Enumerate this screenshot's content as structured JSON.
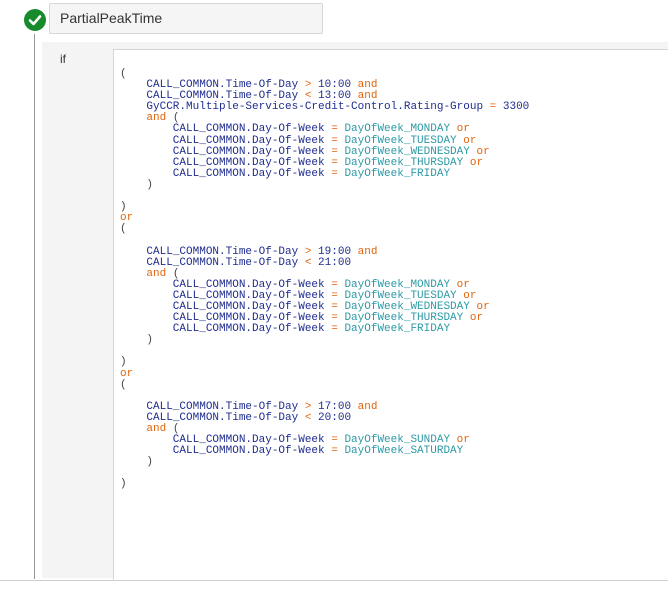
{
  "condition": {
    "name": "PartialPeakTime",
    "status_icon": "check-circle-icon",
    "if_label": "if"
  },
  "colors": {
    "identifier": "#1f2d8f",
    "keyword": "#e2640c",
    "constant": "#2c9aa6",
    "status_ok": "#178a2c"
  },
  "code_lines": [
    [
      {
        "t": "(",
        "k": "p"
      }
    ],
    [
      {
        "t": "    CALL_COMMON.Time-Of-Day ",
        "k": "t"
      },
      {
        "t": ">",
        "k": "k"
      },
      {
        "t": " 10:00 ",
        "k": "t"
      },
      {
        "t": "and",
        "k": "k"
      }
    ],
    [
      {
        "t": "    CALL_COMMON.Time-Of-Day ",
        "k": "t"
      },
      {
        "t": "<",
        "k": "k"
      },
      {
        "t": " 13:00 ",
        "k": "t"
      },
      {
        "t": "and",
        "k": "k"
      }
    ],
    [
      {
        "t": "    GyCCR.Multiple-Services-Credit-Control.Rating-Group ",
        "k": "t"
      },
      {
        "t": "=",
        "k": "k"
      },
      {
        "t": " 3300",
        "k": "t"
      }
    ],
    [
      {
        "t": "    and",
        "k": "k"
      },
      {
        "t": " (",
        "k": "p"
      }
    ],
    [
      {
        "t": "        CALL_COMMON.Day-Of-Week ",
        "k": "t"
      },
      {
        "t": "=",
        "k": "k"
      },
      {
        "t": " DayOfWeek_MONDAY ",
        "k": "c"
      },
      {
        "t": "or",
        "k": "k"
      }
    ],
    [
      {
        "t": "        CALL_COMMON.Day-Of-Week ",
        "k": "t"
      },
      {
        "t": "=",
        "k": "k"
      },
      {
        "t": " DayOfWeek_TUESDAY ",
        "k": "c"
      },
      {
        "t": "or",
        "k": "k"
      }
    ],
    [
      {
        "t": "        CALL_COMMON.Day-Of-Week ",
        "k": "t"
      },
      {
        "t": "=",
        "k": "k"
      },
      {
        "t": " DayOfWeek_WEDNESDAY ",
        "k": "c"
      },
      {
        "t": "or",
        "k": "k"
      }
    ],
    [
      {
        "t": "        CALL_COMMON.Day-Of-Week ",
        "k": "t"
      },
      {
        "t": "=",
        "k": "k"
      },
      {
        "t": " DayOfWeek_THURSDAY ",
        "k": "c"
      },
      {
        "t": "or",
        "k": "k"
      }
    ],
    [
      {
        "t": "        CALL_COMMON.Day-Of-Week ",
        "k": "t"
      },
      {
        "t": "=",
        "k": "k"
      },
      {
        "t": " DayOfWeek_FRIDAY",
        "k": "c"
      }
    ],
    [
      {
        "t": "    )",
        "k": "p"
      }
    ],
    [
      {
        "t": "",
        "k": "p"
      }
    ],
    [
      {
        "t": ")",
        "k": "p"
      }
    ],
    [
      {
        "t": "or",
        "k": "k"
      }
    ],
    [
      {
        "t": "(",
        "k": "p"
      }
    ],
    [
      {
        "t": "",
        "k": "p"
      }
    ],
    [
      {
        "t": "    CALL_COMMON.Time-Of-Day ",
        "k": "t"
      },
      {
        "t": ">",
        "k": "k"
      },
      {
        "t": " 19:00 ",
        "k": "t"
      },
      {
        "t": "and",
        "k": "k"
      }
    ],
    [
      {
        "t": "    CALL_COMMON.Time-Of-Day ",
        "k": "t"
      },
      {
        "t": "<",
        "k": "k"
      },
      {
        "t": " 21:00",
        "k": "t"
      }
    ],
    [
      {
        "t": "    and",
        "k": "k"
      },
      {
        "t": " (",
        "k": "p"
      }
    ],
    [
      {
        "t": "        CALL_COMMON.Day-Of-Week ",
        "k": "t"
      },
      {
        "t": "=",
        "k": "k"
      },
      {
        "t": " DayOfWeek_MONDAY ",
        "k": "c"
      },
      {
        "t": "or",
        "k": "k"
      }
    ],
    [
      {
        "t": "        CALL_COMMON.Day-Of-Week ",
        "k": "t"
      },
      {
        "t": "=",
        "k": "k"
      },
      {
        "t": " DayOfWeek_TUESDAY ",
        "k": "c"
      },
      {
        "t": "or",
        "k": "k"
      }
    ],
    [
      {
        "t": "        CALL_COMMON.Day-Of-Week ",
        "k": "t"
      },
      {
        "t": "=",
        "k": "k"
      },
      {
        "t": " DayOfWeek_WEDNESDAY ",
        "k": "c"
      },
      {
        "t": "or",
        "k": "k"
      }
    ],
    [
      {
        "t": "        CALL_COMMON.Day-Of-Week ",
        "k": "t"
      },
      {
        "t": "=",
        "k": "k"
      },
      {
        "t": " DayOfWeek_THURSDAY ",
        "k": "c"
      },
      {
        "t": "or",
        "k": "k"
      }
    ],
    [
      {
        "t": "        CALL_COMMON.Day-Of-Week ",
        "k": "t"
      },
      {
        "t": "=",
        "k": "k"
      },
      {
        "t": " DayOfWeek_FRIDAY",
        "k": "c"
      }
    ],
    [
      {
        "t": "    )",
        "k": "p"
      }
    ],
    [
      {
        "t": "",
        "k": "p"
      }
    ],
    [
      {
        "t": ")",
        "k": "p"
      }
    ],
    [
      {
        "t": "or",
        "k": "k"
      }
    ],
    [
      {
        "t": "(",
        "k": "p"
      }
    ],
    [
      {
        "t": "",
        "k": "p"
      }
    ],
    [
      {
        "t": "    CALL_COMMON.Time-Of-Day ",
        "k": "t"
      },
      {
        "t": ">",
        "k": "k"
      },
      {
        "t": " 17:00 ",
        "k": "t"
      },
      {
        "t": "and",
        "k": "k"
      }
    ],
    [
      {
        "t": "    CALL_COMMON.Time-Of-Day ",
        "k": "t"
      },
      {
        "t": "<",
        "k": "k"
      },
      {
        "t": " 20:00",
        "k": "t"
      }
    ],
    [
      {
        "t": "    and",
        "k": "k"
      },
      {
        "t": " (",
        "k": "p"
      }
    ],
    [
      {
        "t": "        CALL_COMMON.Day-Of-Week ",
        "k": "t"
      },
      {
        "t": "=",
        "k": "k"
      },
      {
        "t": " DayOfWeek_SUNDAY ",
        "k": "c"
      },
      {
        "t": "or",
        "k": "k"
      }
    ],
    [
      {
        "t": "        CALL_COMMON.Day-Of-Week ",
        "k": "t"
      },
      {
        "t": "=",
        "k": "k"
      },
      {
        "t": " DayOfWeek_SATURDAY",
        "k": "c"
      }
    ],
    [
      {
        "t": "    )",
        "k": "p"
      }
    ],
    [
      {
        "t": "",
        "k": "p"
      }
    ],
    [
      {
        "t": ")",
        "k": "p"
      }
    ]
  ]
}
